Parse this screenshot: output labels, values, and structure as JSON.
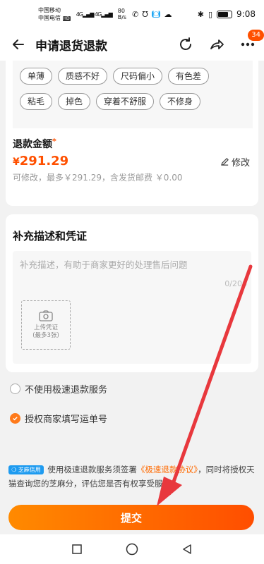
{
  "status_bar": {
    "carrier_1": "中国移动",
    "carrier_2": "中国电信",
    "hd_tag": "HD",
    "signal_1": "4G",
    "signal_2": "4G",
    "net_speed_value": "80",
    "net_speed_unit": "B/s",
    "time": "9:08"
  },
  "nav": {
    "title": "申请退货退款",
    "badge_count": "34"
  },
  "reason_tags": {
    "row1": [
      "单薄",
      "质感不好",
      "尺码偏小",
      "有色差"
    ],
    "row2": [
      "粘毛",
      "掉色",
      "穿着不舒服",
      "不修身"
    ]
  },
  "refund": {
    "label": "退款金额",
    "required_mark": "*",
    "currency": "¥",
    "amount": "291.29",
    "modify_label": "修改",
    "hint": "可修改，最多￥291.29，含发货邮费 ￥0.00"
  },
  "supplement": {
    "title": "补充描述和凭证",
    "placeholder": "补充描述，有助于商家更好的处理售后问题",
    "char_count": "0/200",
    "upload_label": "上传凭证",
    "upload_sub": "(最多3张)"
  },
  "options": {
    "fast_refund_label": "不使用极速退款服务",
    "authorize_label": "授权商家填写运单号"
  },
  "notice": {
    "badge": "芝麻信用",
    "text_before": "使用极速退款服务须签署",
    "agreement": "《极速退款协议》",
    "text_after": "，同时将授权天猫查询您的芝麻分，评估您是否有权享受服务"
  },
  "submit_label": "提交",
  "colors": {
    "accent": "#ff5000",
    "button_gradient_start": "#ff8a00",
    "button_gradient_end": "#ff4e00",
    "annotation_arrow": "#e8383d"
  }
}
